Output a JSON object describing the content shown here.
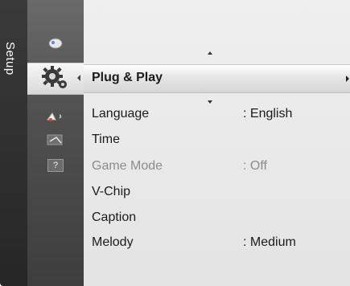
{
  "side_title": "Setup",
  "menu": {
    "selected": {
      "label": "Plug & Play"
    },
    "items": [
      {
        "label": "Language",
        "value": ": English",
        "enabled": true
      },
      {
        "label": "Time",
        "value": "",
        "enabled": true
      },
      {
        "label": "Game Mode",
        "value": ": Off",
        "enabled": false
      },
      {
        "label": "V-Chip",
        "value": "",
        "enabled": true
      },
      {
        "label": "Caption",
        "value": "",
        "enabled": true
      },
      {
        "label": "Melody",
        "value": ": Medium",
        "enabled": true
      }
    ]
  },
  "icons": [
    {
      "name": "picture-icon"
    },
    {
      "name": "setup-gear-icon"
    },
    {
      "name": "sound-icon"
    },
    {
      "name": "input-icon"
    },
    {
      "name": "help-icon",
      "glyph": "?"
    }
  ],
  "colors": {
    "dark_strip": "#2b2b2b",
    "icon_column": "#555555",
    "text": "#1b1b1b",
    "disabled_text": "#8c8c8c"
  }
}
